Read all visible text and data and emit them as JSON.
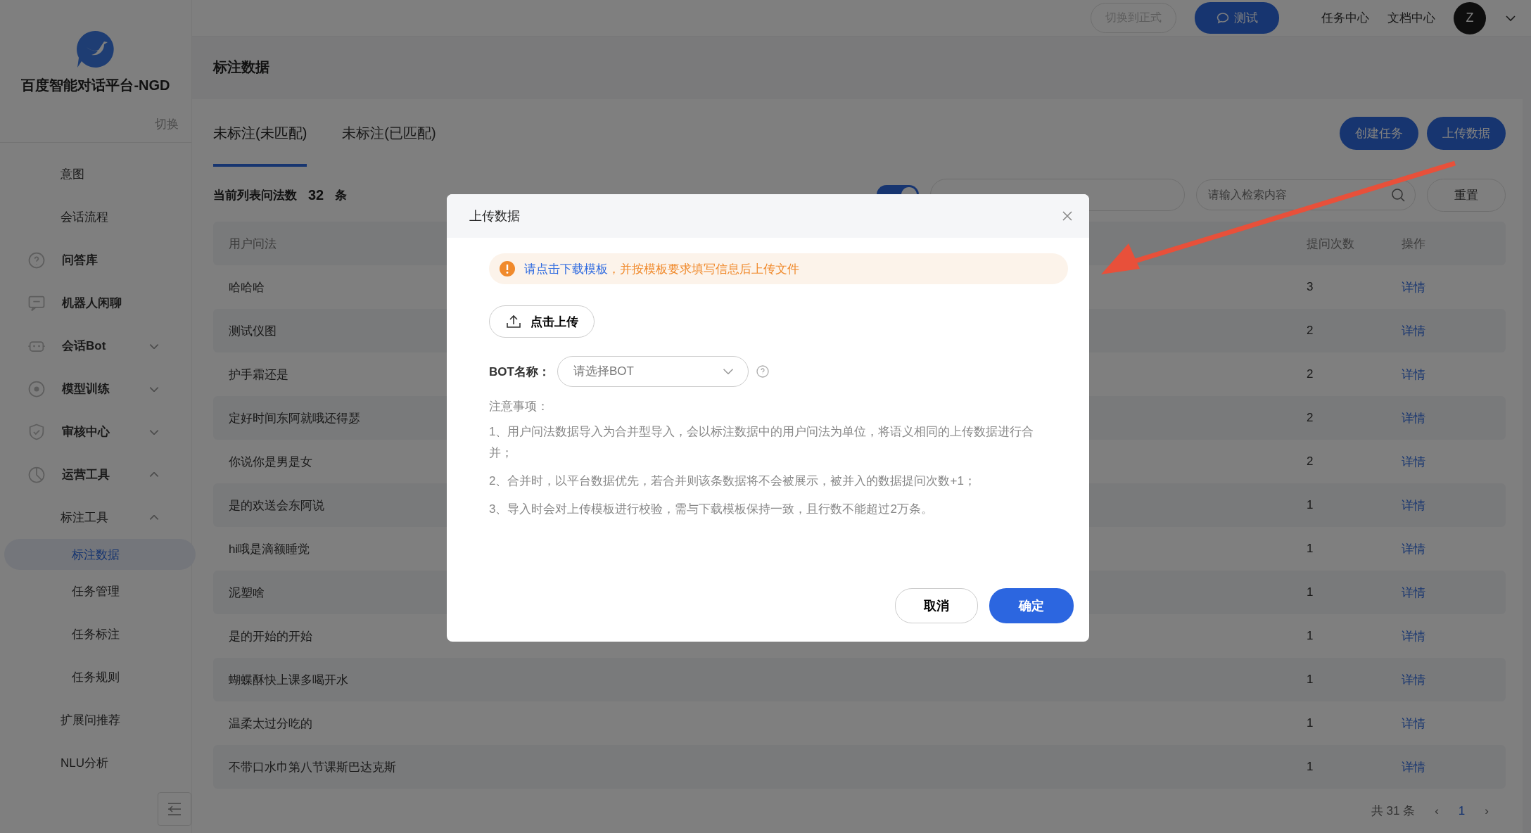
{
  "sidebar": {
    "brand": "百度智能对话平台-NGD",
    "switch_label": "切换",
    "items": [
      {
        "label": "意图",
        "kind": "entry",
        "selected": false
      },
      {
        "label": "会话流程",
        "kind": "entry",
        "selected": false
      },
      {
        "label": "问答库",
        "kind": "module",
        "selected": false
      },
      {
        "label": "机器人闲聊",
        "kind": "module",
        "selected": false
      },
      {
        "label": "会话Bot",
        "kind": "module",
        "selected": false,
        "expanded": false
      },
      {
        "label": "模型训练",
        "kind": "module",
        "selected": false,
        "expanded": false
      },
      {
        "label": "审核中心",
        "kind": "module",
        "selected": false,
        "expanded": false
      },
      {
        "label": "运营工具",
        "kind": "module",
        "selected": false,
        "expanded": true,
        "children": [
          {
            "label": "标注工具",
            "kind": "entry",
            "selected": false,
            "expanded": true,
            "children": [
              {
                "label": "标注数据",
                "kind": "entry",
                "selected": true
              },
              {
                "label": "任务管理",
                "kind": "entry",
                "selected": false
              },
              {
                "label": "任务标注",
                "kind": "entry",
                "selected": false
              },
              {
                "label": "任务规则",
                "kind": "entry",
                "selected": false
              }
            ]
          },
          {
            "label": "扩展问推荐",
            "kind": "entry",
            "selected": false
          },
          {
            "label": "NLU分析",
            "kind": "entry",
            "selected": false
          }
        ]
      }
    ]
  },
  "topbar": {
    "switch_button": "切换到正式",
    "test_button": "测试",
    "links": [
      "任务中心",
      "文档中心"
    ],
    "avatar": "Z"
  },
  "page_title": "标注数据",
  "tabs": [
    {
      "label": "未标注(未匹配)",
      "selected": true
    },
    {
      "label": "未标注(已匹配)",
      "selected": false
    }
  ],
  "actions": [
    "创建任务",
    "上传数据"
  ],
  "count": {
    "label": "当前列表问法数",
    "value": "32",
    "unit": "条"
  },
  "filters": {
    "aggregate_on": true,
    "search_placeholder": "请输入检索内容",
    "reset": "重置"
  },
  "table": {
    "columns": [
      "用户问法",
      "提问次数",
      "操作"
    ],
    "rows": [
      {
        "question": "哈哈哈",
        "count": "3",
        "action": "详情"
      },
      {
        "question": "测试仪图",
        "count": "2",
        "action": "详情"
      },
      {
        "question": "护手霜还是",
        "count": "2",
        "action": "详情"
      },
      {
        "question": "定好时间东阿就哦还得瑟",
        "count": "2",
        "action": "详情"
      },
      {
        "question": "你说你是男是女",
        "count": "2",
        "action": "详情"
      },
      {
        "question": "是的欢送会东阿说",
        "count": "1",
        "action": "详情"
      },
      {
        "question": "hi哦是滴额睡觉",
        "count": "1",
        "action": "详情"
      },
      {
        "question": "泥塑啥",
        "count": "1",
        "action": "详情"
      },
      {
        "question": "是的开始的开始",
        "count": "1",
        "action": "详情"
      },
      {
        "question": "蝴蝶酥快上课多喝开水",
        "count": "1",
        "action": "详情"
      },
      {
        "question": "温柔太过分吃的",
        "count": "1",
        "action": "详情"
      },
      {
        "question": "不带口水巾第八节课斯巴达克斯",
        "count": "1",
        "action": "详情"
      }
    ]
  },
  "pagination": {
    "total": "共 31 条",
    "prev": "‹",
    "pages": [
      {
        "label": "1",
        "selected": true
      }
    ],
    "next": "›"
  },
  "dialog": {
    "title": "上传数据",
    "alert_link": "请点击下载模板",
    "alert_text": "，并按模板要求填写信息后上传文件",
    "upload_button": "点击上传",
    "bot_label": "BOT名称：",
    "bot_placeholder": "请选择BOT",
    "notes_title": "注意事项：",
    "notes": [
      "1、用户问法数据导入为合并型导入，会以标注数据中的用户问法为单位，将语义相同的上传数据进行合并；",
      "2、合并时，以平台数据优先，若合并则该条数据将不会被展示，被并入的数据提问次数+1；",
      "3、导入时会对上传模板进行校验，需与下载模板保持一致，且行数不能超过2万条。"
    ],
    "cancel": "取消",
    "confirm": "确定"
  }
}
